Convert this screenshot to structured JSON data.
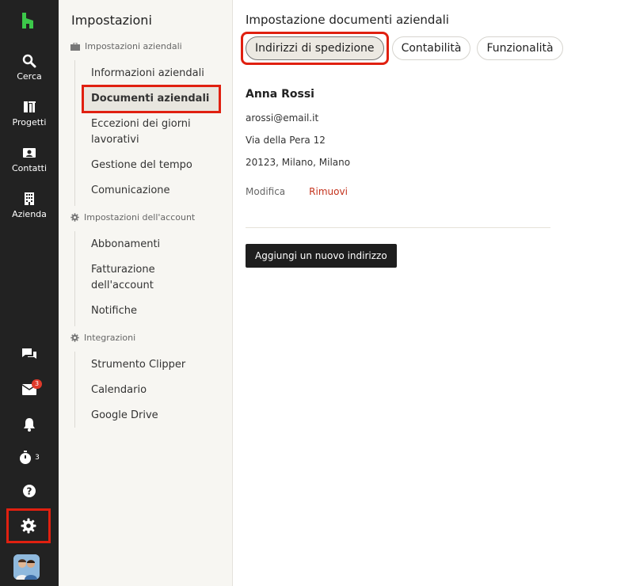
{
  "rail": {
    "search_label": "Cerca",
    "projects_label": "Progetti",
    "contacts_label": "Contatti",
    "company_label": "Azienda",
    "inbox_badge": "3",
    "timer_count": "3"
  },
  "settings_panel": {
    "title": "Impostazioni",
    "sections": [
      {
        "label": "Impostazioni aziendali",
        "items": [
          "Informazioni aziendali",
          "Documenti aziendali",
          "Eccezioni dei giorni lavorativi",
          "Gestione del tempo",
          "Comunicazione"
        ]
      },
      {
        "label": "Impostazioni dell'account",
        "items": [
          "Abbonamenti",
          "Fatturazione dell'account",
          "Notifiche"
        ]
      },
      {
        "label": "Integrazioni",
        "items": [
          "Strumento Clipper",
          "Calendario",
          "Google Drive"
        ]
      }
    ],
    "active_item": "Documenti aziendali"
  },
  "main": {
    "title": "Impostazione documenti aziendali",
    "tabs": [
      "Indirizzi di spedizione",
      "Contabilità",
      "Funzionalità"
    ],
    "active_tab": "Indirizzi di spedizione",
    "address": {
      "name": "Anna Rossi",
      "email": "arossi@email.it",
      "street": "Via della Pera 12",
      "city": "20123, Milano, Milano"
    },
    "edit_label": "Modifica",
    "remove_label": "Rimuovi",
    "add_button": "Aggiungi un nuovo indirizzo"
  },
  "colors": {
    "rail_bg": "#222222",
    "brand_green": "#3cc84a",
    "highlight_red": "#e02010",
    "remove_red": "#c4321c"
  }
}
